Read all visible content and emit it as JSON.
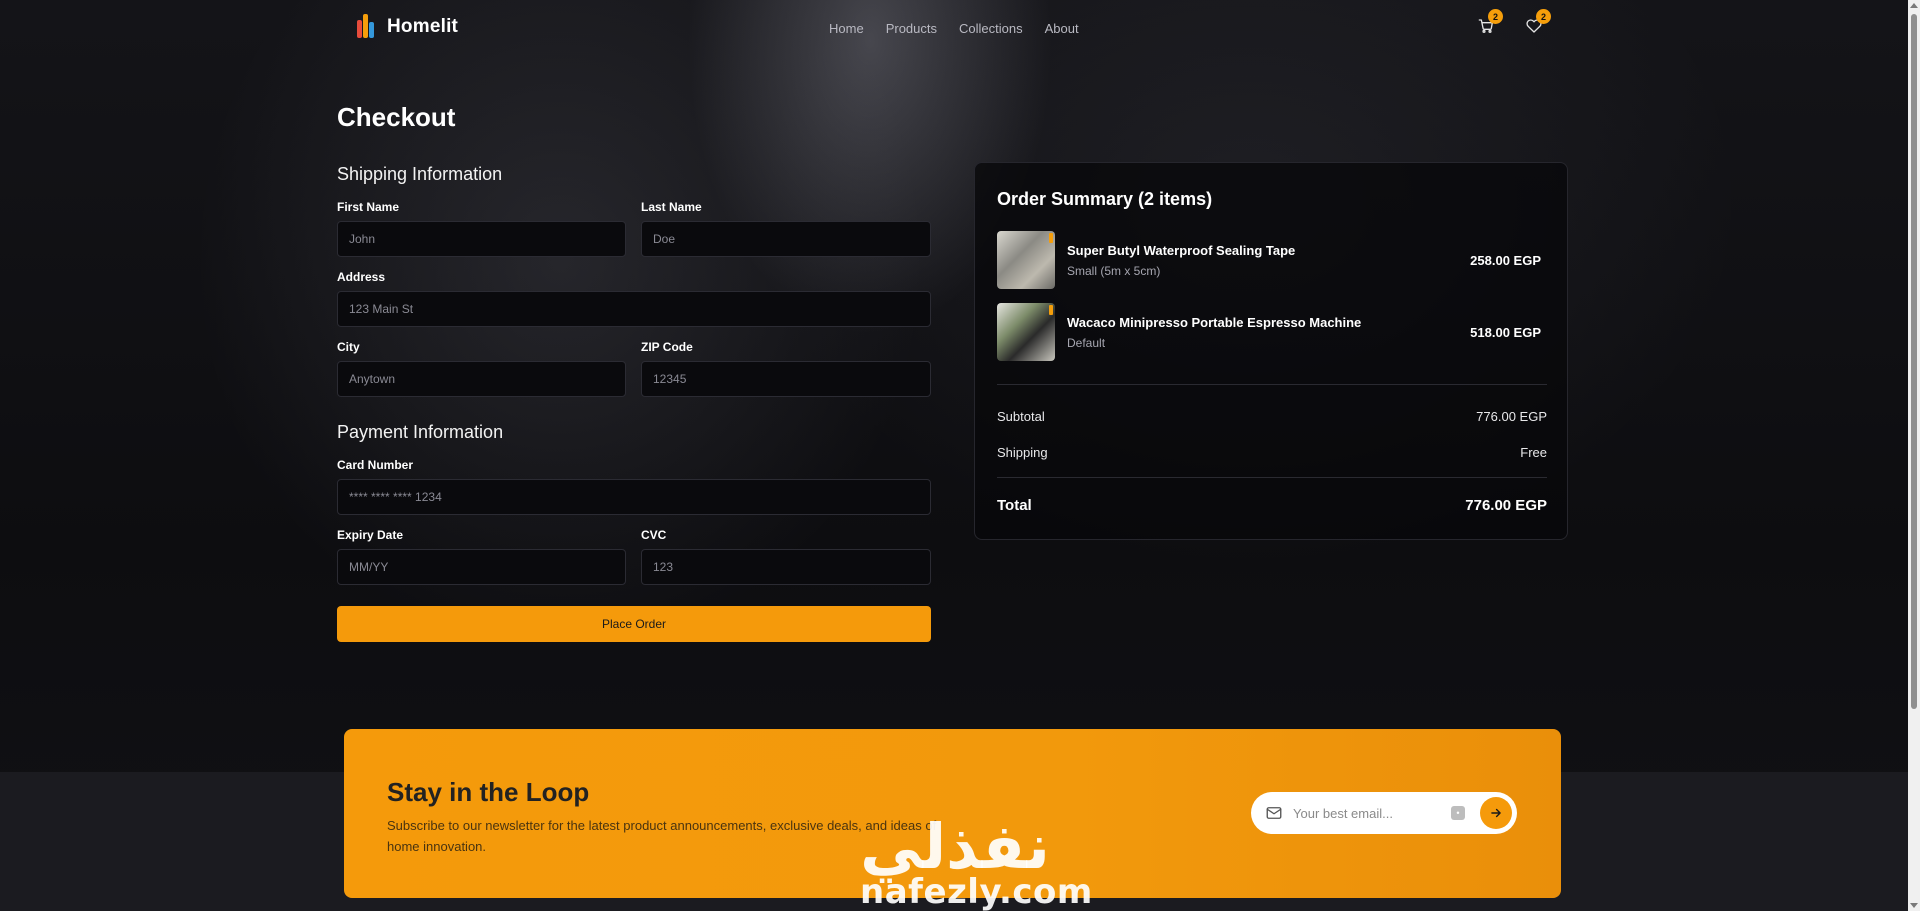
{
  "header": {
    "brand": "Homelit",
    "nav": [
      "Home",
      "Products",
      "Collections",
      "About"
    ],
    "cart_count": "2",
    "wishlist_count": "2"
  },
  "checkout": {
    "title": "Checkout",
    "shipping": {
      "title": "Shipping Information",
      "first_name": {
        "label": "First Name",
        "placeholder": "John"
      },
      "last_name": {
        "label": "Last Name",
        "placeholder": "Doe"
      },
      "address": {
        "label": "Address",
        "placeholder": "123 Main St"
      },
      "city": {
        "label": "City",
        "placeholder": "Anytown"
      },
      "zip": {
        "label": "ZIP Code",
        "placeholder": "12345"
      }
    },
    "payment": {
      "title": "Payment Information",
      "card_number": {
        "label": "Card Number",
        "placeholder": "**** **** **** 1234"
      },
      "expiry": {
        "label": "Expiry Date",
        "placeholder": "MM/YY"
      },
      "cvc": {
        "label": "CVC",
        "placeholder": "123"
      }
    },
    "place_order_label": "Place Order"
  },
  "summary": {
    "title": "Order Summary (2 items)",
    "items": [
      {
        "name": "Super Butyl Waterproof Sealing Tape",
        "variant": "Small (5m x 5cm)",
        "price": "258.00 EGP"
      },
      {
        "name": "Wacaco Minipresso Portable Espresso Machine",
        "variant": "Default",
        "price": "518.00 EGP"
      }
    ],
    "subtotal_label": "Subtotal",
    "subtotal_value": "776.00 EGP",
    "shipping_label": "Shipping",
    "shipping_value": "Free",
    "total_label": "Total",
    "total_value": "776.00 EGP"
  },
  "newsletter": {
    "title": "Stay in the Loop",
    "subtitle": "Subscribe to our newsletter for the latest product announcements, exclusive deals, and ideas of home innovation.",
    "email_placeholder": "Your best email..."
  },
  "watermark": {
    "arabic": "نفذلي",
    "latin": "nafezly.com"
  },
  "colors": {
    "accent": "#f59a0b",
    "background": "#0b0b0e",
    "card": "#0a0a0d"
  }
}
